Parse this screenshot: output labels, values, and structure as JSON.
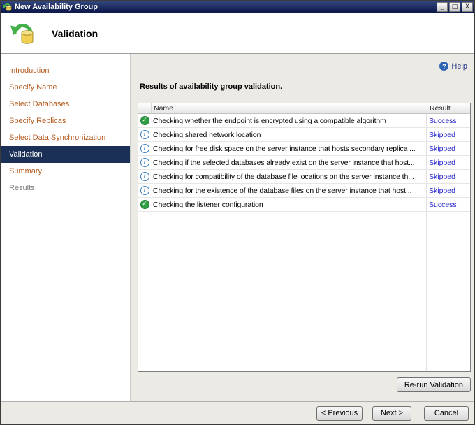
{
  "window": {
    "title": "New Availability Group",
    "controls": {
      "minimize": "_",
      "maximize": "□",
      "close": "X"
    }
  },
  "header": {
    "title": "Validation"
  },
  "sidebar": {
    "items": [
      {
        "label": "Introduction",
        "state": "normal"
      },
      {
        "label": "Specify Name",
        "state": "normal"
      },
      {
        "label": "Select Databases",
        "state": "normal"
      },
      {
        "label": "Specify Replicas",
        "state": "normal"
      },
      {
        "label": "Select Data Synchronization",
        "state": "normal"
      },
      {
        "label": "Validation",
        "state": "selected"
      },
      {
        "label": "Summary",
        "state": "normal"
      },
      {
        "label": "Results",
        "state": "disabled"
      }
    ]
  },
  "main": {
    "help_label": "Help",
    "heading": "Results of availability group validation.",
    "table": {
      "columns": [
        "Name",
        "Result"
      ],
      "rows": [
        {
          "icon": "success",
          "name": "Checking whether the endpoint is encrypted using a compatible algorithm",
          "result": "Success"
        },
        {
          "icon": "info",
          "name": "Checking shared network location",
          "result": "Skipped"
        },
        {
          "icon": "info",
          "name": "Checking for free disk space on the server instance that hosts secondary replica ...",
          "result": "Skipped"
        },
        {
          "icon": "info",
          "name": "Checking if the selected databases already exist on the server instance that host...",
          "result": "Skipped"
        },
        {
          "icon": "info",
          "name": "Checking for compatibility of the database file locations on the server instance th...",
          "result": "Skipped"
        },
        {
          "icon": "info",
          "name": "Checking for the existence of the database files on the server instance that host...",
          "result": "Skipped"
        },
        {
          "icon": "success",
          "name": "Checking the listener configuration",
          "result": "Success"
        }
      ]
    },
    "rerun_button": "Re-run Validation"
  },
  "footer": {
    "previous": "< Previous",
    "next": "Next >",
    "cancel": "Cancel"
  },
  "icons": {
    "success_glyph": "✓",
    "info_glyph": "i",
    "help_glyph": "?"
  },
  "colors": {
    "titlebar": "#101c4e",
    "titlebar_light": "#35497f",
    "sidebar_selected": "#1a3057",
    "link_orange": "#b55a1e",
    "result_link": "#2222cc",
    "success_green": "#2f9e44",
    "info_blue": "#3a7ebf",
    "help_blue": "#2d62b0"
  }
}
